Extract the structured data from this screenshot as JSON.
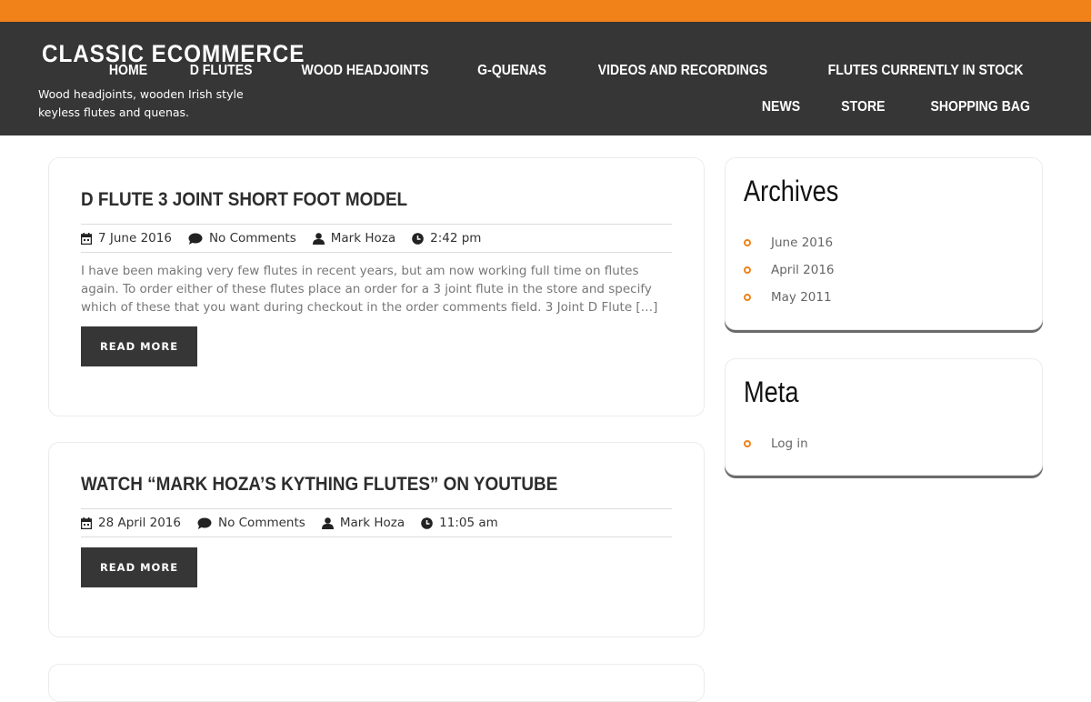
{
  "colors": {
    "accent": "#f08219",
    "header_bg": "#363636",
    "button_bg": "#363636"
  },
  "site": {
    "title": "CLASSIC ECOMMERCE",
    "tagline": "Wood headjoints, wooden Irish style keyless flutes and quenas."
  },
  "nav": {
    "row1": [
      "HOME",
      "D FLUTES",
      "WOOD HEADJOINTS",
      "G-QUENAS",
      "VIDEOS AND RECORDINGS",
      "FLUTES CURRENTLY IN STOCK"
    ],
    "row2": [
      "NEWS",
      "STORE",
      "SHOPPING BAG"
    ]
  },
  "posts": [
    {
      "title": "D FLUTE 3 JOINT SHORT FOOT MODEL",
      "date": "7 June 2016",
      "comments": "No Comments",
      "author": "Mark Hoza",
      "time": "2:42 pm",
      "excerpt": "I have been making very few flutes in recent years, but am now working full time on flutes again. To order either of these flutes place an order for a 3 joint flute in the store and specify which of these that you want during checkout in the order comments field. 3 Joint D Flute […]",
      "button": "READ MORE"
    },
    {
      "title": "WATCH “MARK HOZA’S KYTHING FLUTES” ON YOUTUBE",
      "date": "28 April 2016",
      "comments": "No Comments",
      "author": "Mark Hoza",
      "time": "11:05 am",
      "button": "READ MORE"
    }
  ],
  "sidebar": {
    "archives": {
      "title": "Archives",
      "items": [
        "June 2016",
        "April 2016",
        "May 2011"
      ]
    },
    "meta": {
      "title": "Meta",
      "items": [
        "Log in"
      ]
    }
  }
}
